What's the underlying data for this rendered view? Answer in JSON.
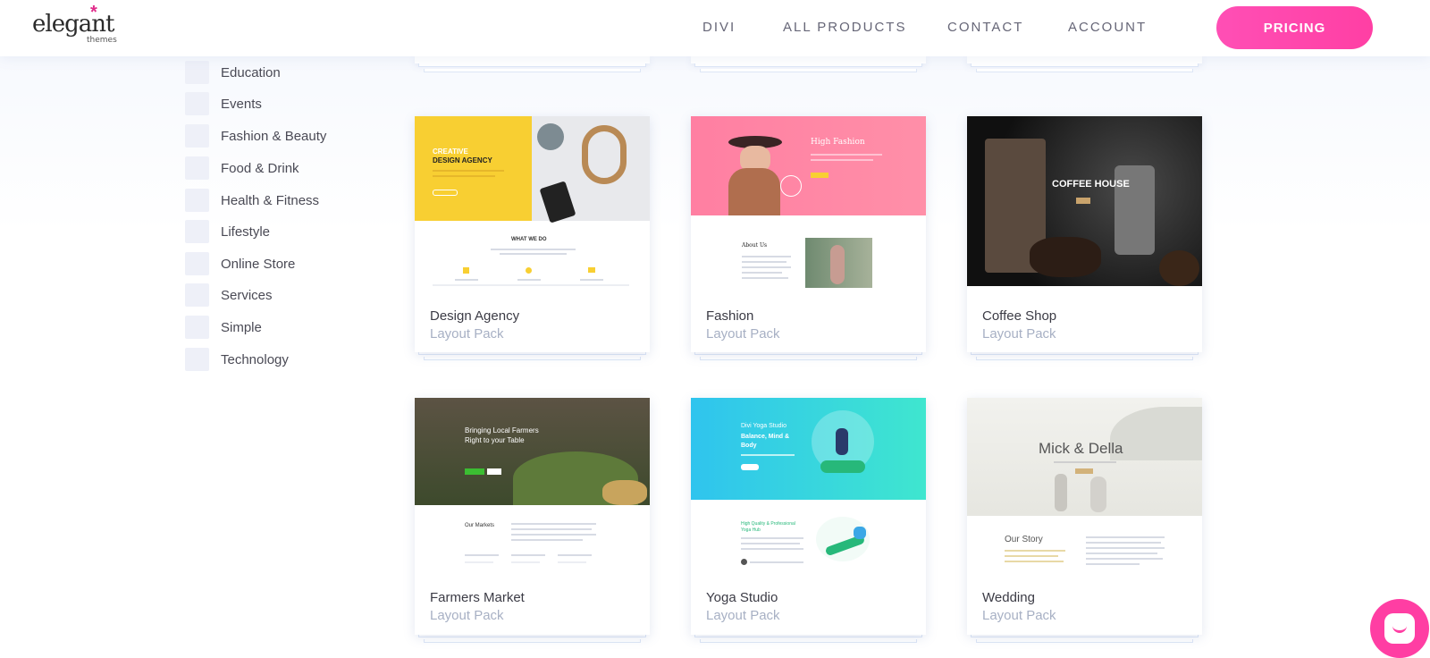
{
  "header": {
    "logo_text": "elegant",
    "logo_sub": "themes",
    "nav": [
      "DIVI",
      "ALL PRODUCTS",
      "CONTACT",
      "ACCOUNT"
    ],
    "pricing_label": "PRICING"
  },
  "sidebar": {
    "categories": [
      "Education",
      "Events",
      "Fashion & Beauty",
      "Food & Drink",
      "Health & Fitness",
      "Lifestyle",
      "Online Store",
      "Services",
      "Simple",
      "Technology"
    ]
  },
  "cards": [
    {
      "title": "Design Agency",
      "subtitle": "Layout Pack"
    },
    {
      "title": "Fashion",
      "subtitle": "Layout Pack"
    },
    {
      "title": "Coffee Shop",
      "subtitle": "Layout Pack"
    },
    {
      "title": "Farmers Market",
      "subtitle": "Layout Pack"
    },
    {
      "title": "Yoga Studio",
      "subtitle": "Layout Pack"
    },
    {
      "title": "Wedding",
      "subtitle": "Layout Pack"
    }
  ],
  "thumbs": {
    "design_agency": {
      "headline_1": "CREATIVE",
      "headline_2": "DESIGN AGENCY",
      "section": "WHAT WE DO"
    },
    "fashion": {
      "headline": "High Fashion",
      "section": "About Us"
    },
    "coffee": {
      "headline": "COFFEE HOUSE"
    },
    "farmers": {
      "headline_1": "Bringing Local Farmers",
      "headline_2": "Right to your Table",
      "section": "Our Markets"
    },
    "yoga": {
      "headline_1": "Divi Yoga Studio",
      "headline_2": "Balance, Mind &",
      "headline_3": "Body",
      "section_1": "High Quality & Professional",
      "section_2": "Yoga Hub"
    },
    "wedding": {
      "headline": "Mick & Della",
      "section": "Our Story"
    }
  },
  "chat": {
    "icon": "chat-icon"
  },
  "colors": {
    "accent": "#ff3ea3",
    "nav": "#667",
    "subtitle": "#a7b0c4"
  }
}
